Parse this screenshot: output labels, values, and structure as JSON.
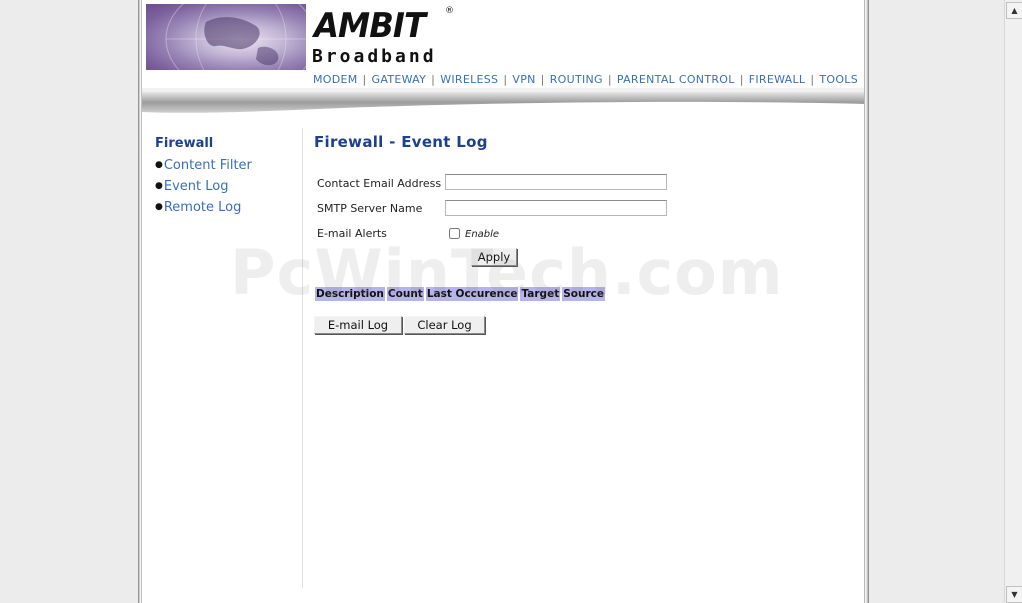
{
  "brand": {
    "name": "AMBIT",
    "registered_mark": "®",
    "tagline": "Broadband"
  },
  "topnav": [
    {
      "label": "MODEM"
    },
    {
      "label": "GATEWAY"
    },
    {
      "label": "WIRELESS"
    },
    {
      "label": "VPN"
    },
    {
      "label": "ROUTING"
    },
    {
      "label": "PARENTAL CONTROL"
    },
    {
      "label": "FIREWALL"
    },
    {
      "label": "TOOLS"
    }
  ],
  "sidenav": {
    "title": "Firewall",
    "items": [
      {
        "label": "Content Filter"
      },
      {
        "label": "Event Log"
      },
      {
        "label": "Remote Log"
      }
    ]
  },
  "main": {
    "heading": "Firewall - Event Log",
    "form": {
      "contact_email_label": "Contact Email Address",
      "contact_email_value": "",
      "smtp_label": "SMTP Server Name",
      "smtp_value": "",
      "alerts_label": "E-mail Alerts",
      "enable_label": "Enable",
      "enable_checked": false,
      "apply_label": "Apply"
    },
    "log_table": {
      "columns": [
        "Description",
        "Count",
        "Last Occurence",
        "Target",
        "Source"
      ],
      "rows": []
    },
    "email_log_label": "E-mail Log",
    "clear_log_label": "Clear Log"
  },
  "watermark": "PcWinTech.com",
  "colors": {
    "accent_blue": "#1f3f8f",
    "link_blue": "#3a6fb8",
    "table_header": "#b5b3ec"
  }
}
